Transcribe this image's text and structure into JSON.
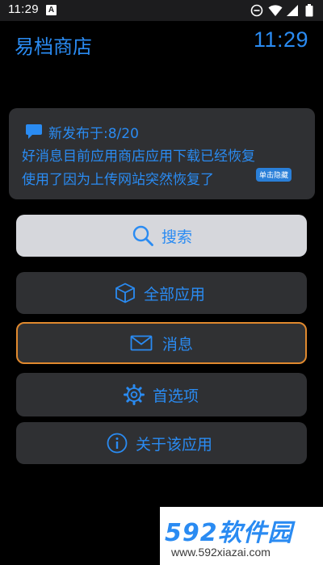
{
  "status_bar": {
    "time": "11:29",
    "notification_badge": "A",
    "icons": [
      "dnd-icon",
      "wifi-icon",
      "signal-icon",
      "battery-icon"
    ]
  },
  "header": {
    "app_title": "易档商店",
    "clock": "11:29"
  },
  "notice": {
    "date_line": "新发布于:8/20",
    "line1": "好消息目前应用商店应用下载已经恢复",
    "line2": "使用了因为上传网站突然恢复了",
    "hide_label": "单击隐藏"
  },
  "menu": {
    "search": "搜索",
    "all_apps": "全部应用",
    "messages": "消息",
    "preferences": "首选项",
    "about": "关于该应用"
  },
  "watermark": {
    "brand": "592软件园",
    "url": "www.592xiazai.com"
  },
  "colors": {
    "accent": "#2a8bf2",
    "background": "#000000",
    "card": "#2f3033",
    "focus_border": "#e0892e",
    "search_button": "#d6d7dc"
  }
}
